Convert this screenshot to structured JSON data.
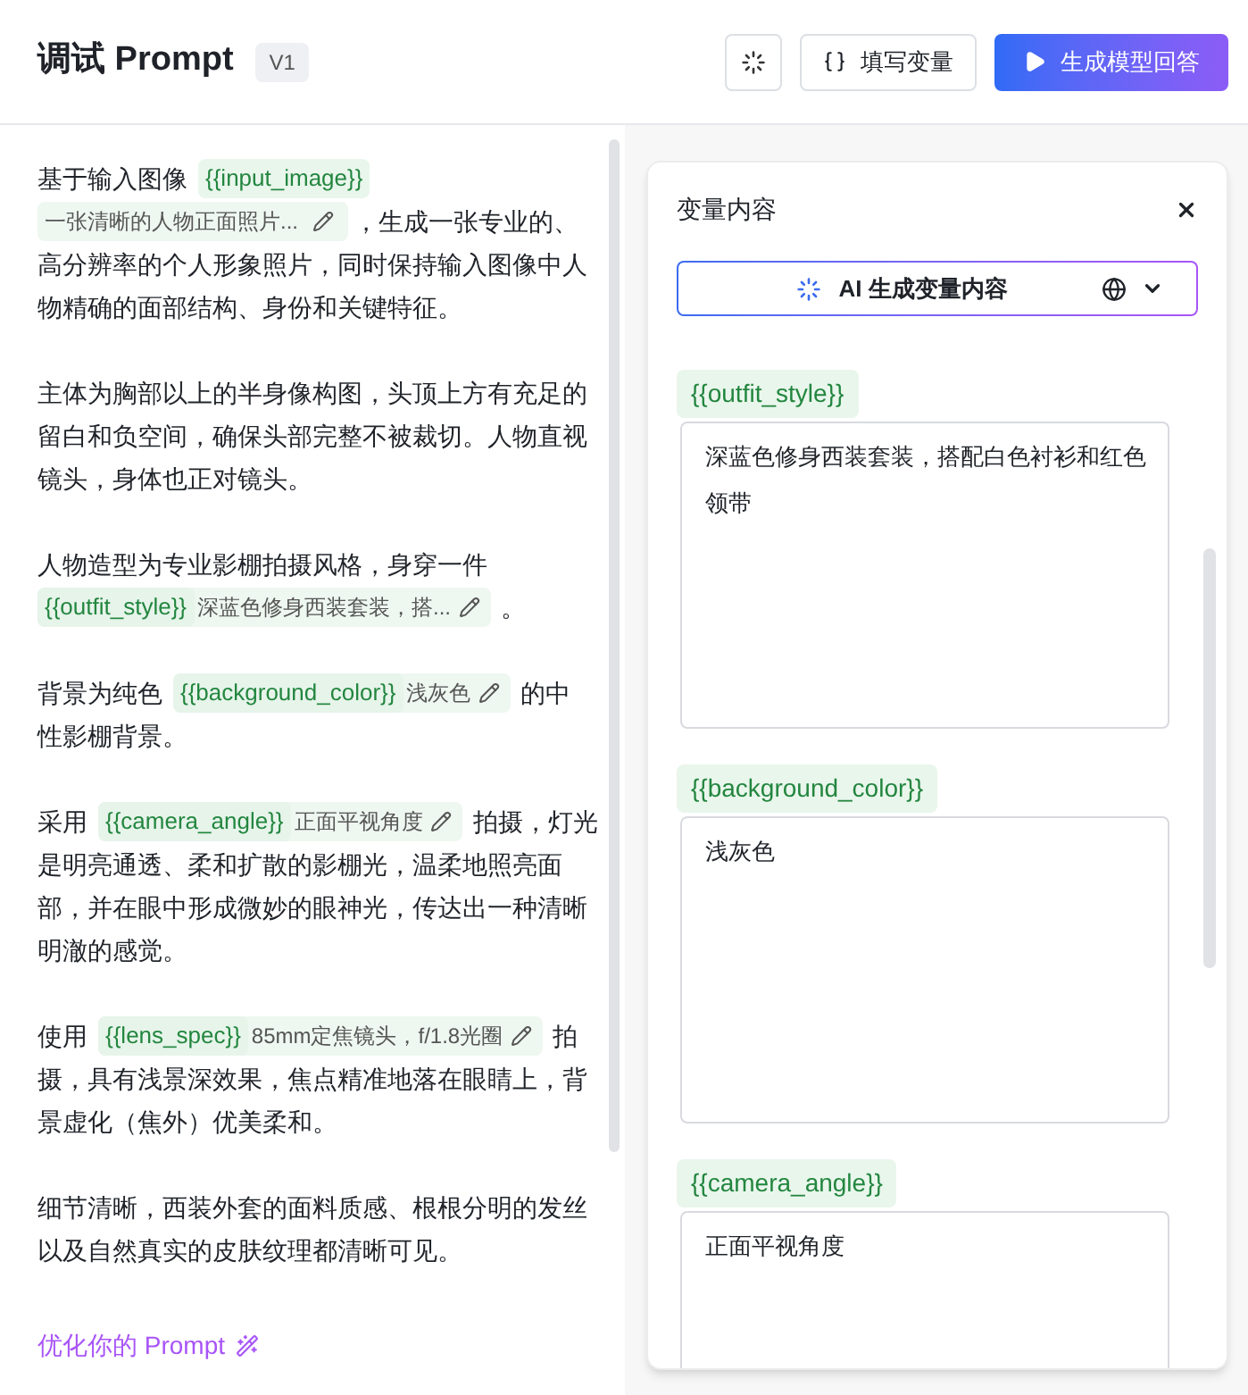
{
  "header": {
    "title": "调试 Prompt",
    "version": "V1",
    "buttons": [
      {
        "kind": "icon"
      },
      {
        "kind": "outline",
        "label": "填写变量"
      },
      {
        "kind": "primary",
        "label": "生成模型回答"
      }
    ]
  },
  "prompt": {
    "paragraphs": [
      [
        [
          {
            "kind": "text",
            "text": "基于输入图像"
          },
          {
            "kind": "variable_name",
            "name": "{{input_image}}"
          }
        ],
        [
          {
            "kind": "variable_value",
            "value": "一张清晰的人物正面照片..."
          },
          {
            "kind": "text",
            "text": "，生成一张专业的、"
          }
        ],
        [
          {
            "kind": "text",
            "text": "高分辨率的个人形象照片，同时保持输入图像中人"
          }
        ],
        [
          {
            "kind": "text",
            "text": "物精确的面部结构、身份和关键特征。"
          }
        ]
      ],
      [
        [
          {
            "kind": "text",
            "text": "主体为胸部以上的半身像构图，头顶上方有充足的"
          }
        ],
        [
          {
            "kind": "text",
            "text": "留白和负空间，确保头部完整不被裁切。人物直视"
          }
        ],
        [
          {
            "kind": "text",
            "text": "镜头，身体也正对镜头。"
          }
        ]
      ],
      [
        [
          {
            "kind": "text",
            "text": "人物造型为专业影棚拍摄风格，身穿一件"
          }
        ],
        [
          {
            "kind": "variable",
            "name": "{{outfit_style}}",
            "value": "深蓝色修身西装套装，搭..."
          },
          {
            "kind": "text",
            "text": "。"
          }
        ]
      ],
      [
        [
          {
            "kind": "text",
            "text": "背景为纯色"
          },
          {
            "kind": "variable",
            "name": "{{background_color}}",
            "value": "浅灰色"
          },
          {
            "kind": "text",
            "text": "的中"
          }
        ],
        [
          {
            "kind": "text",
            "text": "性影棚背景。"
          }
        ]
      ],
      [
        [
          {
            "kind": "text",
            "text": "采用"
          },
          {
            "kind": "variable",
            "name": "{{camera_angle}}",
            "value": "正面平视角度"
          },
          {
            "kind": "text",
            "text": "拍摄，灯光"
          }
        ],
        [
          {
            "kind": "text",
            "text": "是明亮通透、柔和扩散的影棚光，温柔地照亮面"
          }
        ],
        [
          {
            "kind": "text",
            "text": "部，并在眼中形成微妙的眼神光，传达出一种清晰"
          }
        ],
        [
          {
            "kind": "text",
            "text": "明澈的感觉。"
          }
        ]
      ],
      [
        [
          {
            "kind": "text",
            "text": "使用"
          },
          {
            "kind": "variable",
            "name": "{{lens_spec}}",
            "value": "85mm定焦镜头，f/1.8光圈"
          },
          {
            "kind": "text",
            "text": "拍"
          }
        ],
        [
          {
            "kind": "text",
            "text": "摄，具有浅景深效果，焦点精准地落在眼睛上，背"
          }
        ],
        [
          {
            "kind": "text",
            "text": "景虚化（焦外）优美柔和。"
          }
        ]
      ],
      [
        [
          {
            "kind": "text",
            "text": "细节清晰，西装外套的面料质感、根根分明的发丝"
          }
        ],
        [
          {
            "kind": "text",
            "text": "以及自然真实的皮肤纹理都清晰可见。"
          }
        ]
      ]
    ],
    "optimize_link": "优化你的 Prompt"
  },
  "variables_panel": {
    "title": "变量内容",
    "generate_button": "AI 生成变量内容",
    "variables": [
      {
        "name": "{{outfit_style}}",
        "value": "深蓝色修身西装套装，搭配白色衬衫和红色领带"
      },
      {
        "name": "{{background_color}}",
        "value": "浅灰色"
      },
      {
        "name": "{{camera_angle}}",
        "value": "正面平视角度"
      }
    ]
  }
}
